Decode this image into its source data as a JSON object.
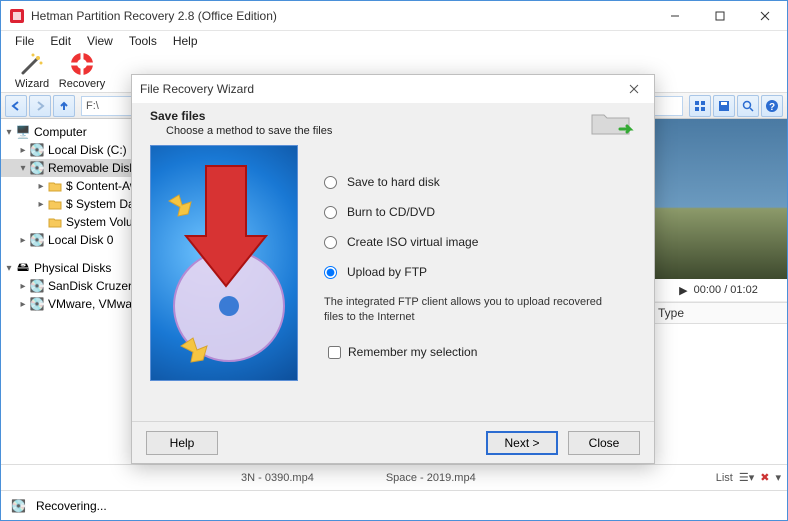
{
  "window": {
    "title": "Hetman Partition Recovery 2.8 (Office Edition)"
  },
  "menu": {
    "file": "File",
    "edit": "Edit",
    "view": "View",
    "tools": "Tools",
    "help": "Help"
  },
  "toolbar": {
    "wizard": "Wizard",
    "recovery": "Recovery"
  },
  "address": "F:\\",
  "tree": {
    "computer": "Computer",
    "localC": "Local Disk (C:)",
    "removable": "Removable Disk",
    "contentAw": "$ Content-Aw",
    "systemDat": "$ System Dat",
    "systemVol": "System Volum",
    "local0": "Local Disk 0",
    "physical": "Physical Disks",
    "sandisk": "SanDisk Cruzer B",
    "vmware": "VMware, VMware"
  },
  "preview": {
    "time": "00:00 / 01:02"
  },
  "columns": {
    "type": "Type"
  },
  "dialog": {
    "title": "File Recovery Wizard",
    "heading": "Save files",
    "sub": "Choose a method to save the files",
    "opt1": "Save to hard disk",
    "opt2": "Burn to CD/DVD",
    "opt3": "Create ISO virtual image",
    "opt4": "Upload by FTP",
    "desc": "The integrated FTP client allows you to upload recovered files to the Internet",
    "remember": "Remember my selection",
    "help": "Help",
    "next": "Next >",
    "close": "Close"
  },
  "bottom": {
    "item1": "3N - 0390.mp4",
    "item2": "Space - 2019.mp4",
    "listLabel": "List",
    "status": "Recovering..."
  }
}
